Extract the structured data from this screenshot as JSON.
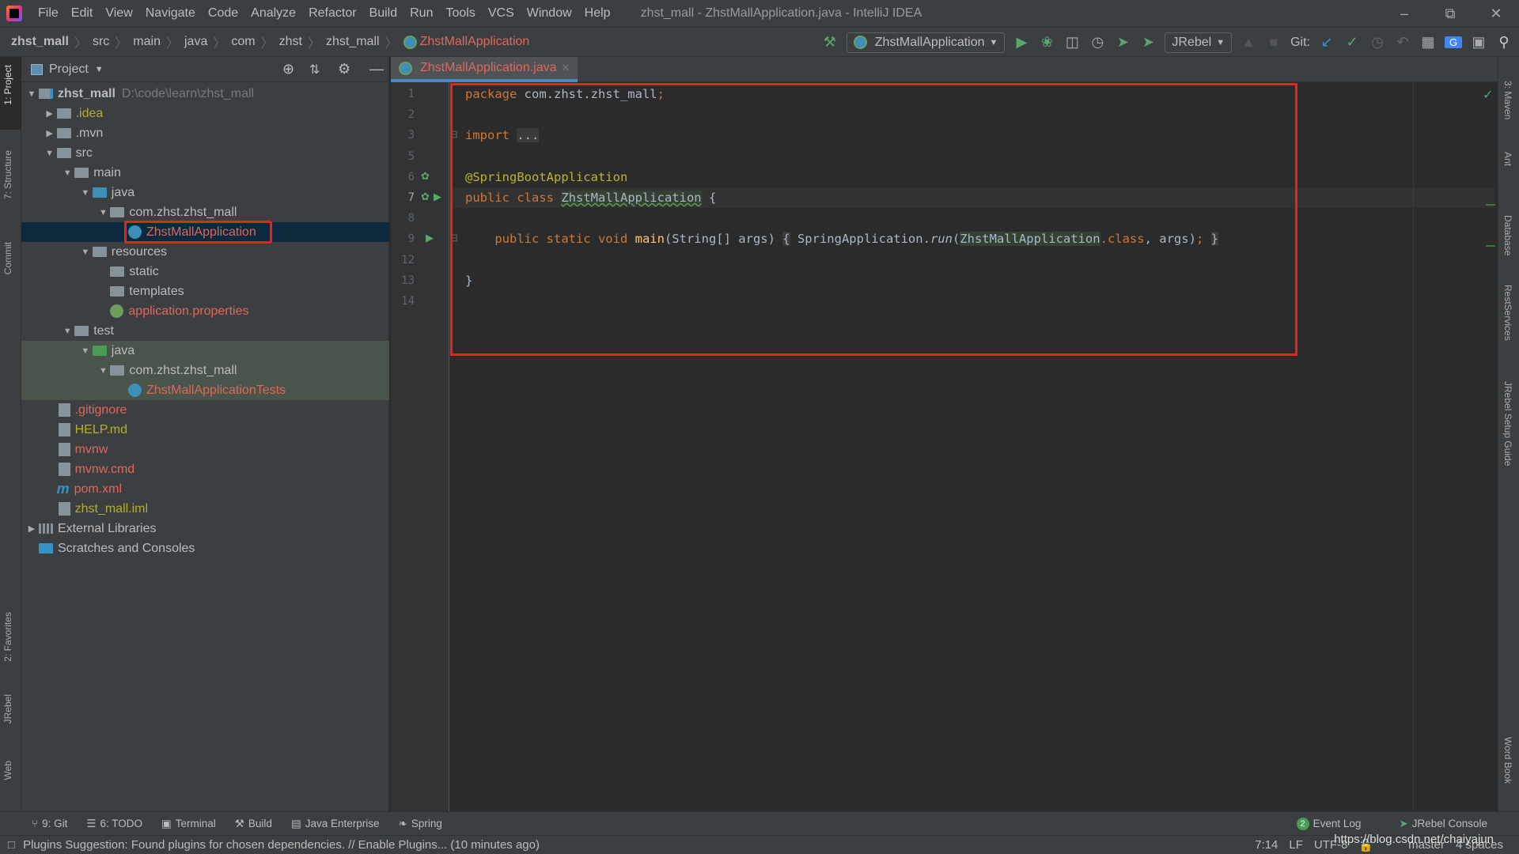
{
  "window": {
    "title": "zhst_mall - ZhstMallApplication.java - IntelliJ IDEA"
  },
  "menu": [
    "File",
    "Edit",
    "View",
    "Navigate",
    "Code",
    "Analyze",
    "Refactor",
    "Build",
    "Run",
    "Tools",
    "VCS",
    "Window",
    "Help"
  ],
  "breadcrumb": [
    "zhst_mall",
    "src",
    "main",
    "java",
    "com",
    "zhst",
    "zhst_mall",
    "ZhstMallApplication"
  ],
  "toolbar": {
    "run_config": "ZhstMallApplication",
    "jrebel": "JRebel",
    "git_label": "Git:"
  },
  "left_strip": [
    "1: Project",
    "7: Structure",
    "Commit",
    "2: Favorites",
    "JRebel",
    "Web"
  ],
  "right_strip": [
    "3: Maven",
    "Ant",
    "Database",
    "RestServices",
    "JRebel Setup Guide",
    "Word Book"
  ],
  "project": {
    "title": "Project",
    "tree": [
      {
        "label": "zhst_mall",
        "path": "D:\\code\\learn\\zhst_mall",
        "level": 0,
        "arrow": "down",
        "icon": "module-folder",
        "color": "#bbbbbb"
      },
      {
        "label": ".idea",
        "level": 1,
        "arrow": "right",
        "icon": "folder",
        "color": "#b3ae28"
      },
      {
        "label": ".mvn",
        "level": 1,
        "arrow": "right",
        "icon": "folder",
        "color": "#bbbbbb"
      },
      {
        "label": "src",
        "level": 1,
        "arrow": "down",
        "icon": "folder",
        "color": "#bbbbbb"
      },
      {
        "label": "main",
        "level": 2,
        "arrow": "down",
        "icon": "folder",
        "color": "#bbbbbb"
      },
      {
        "label": "java",
        "level": 3,
        "arrow": "down",
        "icon": "source-folder",
        "color": "#bbbbbb"
      },
      {
        "label": "com.zhst.zhst_mall",
        "level": 4,
        "arrow": "down",
        "icon": "package",
        "color": "#bbbbbb"
      },
      {
        "label": "ZhstMallApplication",
        "level": 5,
        "arrow": "",
        "icon": "spring-class",
        "color": "#e0665a",
        "selected": true
      },
      {
        "label": "resources",
        "level": 3,
        "arrow": "down",
        "icon": "resources-folder",
        "color": "#bbbbbb"
      },
      {
        "label": "static",
        "level": 4,
        "arrow": "",
        "icon": "folder",
        "color": "#bbbbbb"
      },
      {
        "label": "templates",
        "level": 4,
        "arrow": "",
        "icon": "folder",
        "color": "#bbbbbb"
      },
      {
        "label": "application.properties",
        "level": 4,
        "arrow": "",
        "icon": "spring-properties",
        "color": "#e0665a"
      },
      {
        "label": "test",
        "level": 2,
        "arrow": "down",
        "icon": "folder",
        "color": "#bbbbbb"
      },
      {
        "label": "java",
        "level": 3,
        "arrow": "down",
        "icon": "test-folder",
        "color": "#bbbbbb",
        "test": true
      },
      {
        "label": "com.zhst.zhst_mall",
        "level": 4,
        "arrow": "down",
        "icon": "package",
        "color": "#bbbbbb",
        "test": true
      },
      {
        "label": "ZhstMallApplicationTests",
        "level": 5,
        "arrow": "",
        "icon": "class",
        "color": "#e0665a",
        "test": true
      },
      {
        "label": ".gitignore",
        "level": 1,
        "arrow": "",
        "icon": "gitignore-file",
        "color": "#e0665a"
      },
      {
        "label": "HELP.md",
        "level": 1,
        "arrow": "",
        "icon": "markdown-file",
        "color": "#b3ae28"
      },
      {
        "label": "mvnw",
        "level": 1,
        "arrow": "",
        "icon": "shell-file",
        "color": "#e0665a"
      },
      {
        "label": "mvnw.cmd",
        "level": 1,
        "arrow": "",
        "icon": "text-file",
        "color": "#e0665a"
      },
      {
        "label": "pom.xml",
        "level": 1,
        "arrow": "",
        "icon": "maven-file",
        "color": "#e0665a"
      },
      {
        "label": "zhst_mall.iml",
        "level": 1,
        "arrow": "",
        "icon": "iml-file",
        "color": "#b3ae28"
      },
      {
        "label": "External Libraries",
        "level": 0,
        "arrow": "right",
        "icon": "libraries",
        "color": "#bbbbbb"
      },
      {
        "label": "Scratches and Consoles",
        "level": 0,
        "arrow": "",
        "icon": "scratches",
        "color": "#bbbbbb"
      }
    ]
  },
  "editor": {
    "tab": "ZhstMallApplication.java",
    "current_line": "7",
    "lines": [
      {
        "n": "1",
        "tokens": [
          {
            "t": "package ",
            "c": "kw"
          },
          {
            "t": "com.zhst.zhst_mall"
          },
          {
            "t": ";",
            "c": "kw"
          }
        ]
      },
      {
        "n": "2",
        "tokens": []
      },
      {
        "n": "3",
        "tokens": [
          {
            "t": "import ",
            "c": "kw"
          },
          {
            "t": "...",
            "c": "fold"
          }
        ]
      },
      {
        "n": "5",
        "tokens": []
      },
      {
        "n": "6",
        "tokens": [
          {
            "t": "@SpringBootApplication",
            "c": "ann"
          }
        ]
      },
      {
        "n": "7",
        "tokens": [
          {
            "t": "public class ",
            "c": "kw"
          },
          {
            "t": "ZhstMallApplication",
            "c": "hl ul"
          },
          {
            "t": " {"
          }
        ]
      },
      {
        "n": "8",
        "tokens": []
      },
      {
        "n": "9",
        "tokens": [
          {
            "t": "    public static void ",
            "c": "kw"
          },
          {
            "t": "main",
            "c": "fn"
          },
          {
            "t": "(String[] args) "
          },
          {
            "t": "{",
            "c": "fold"
          },
          {
            "t": " SpringApplication."
          },
          {
            "t": "run",
            "c": "it"
          },
          {
            "t": "("
          },
          {
            "t": "ZhstMallApplication",
            "c": "hl"
          },
          {
            "t": ".",
            "c": "kw"
          },
          {
            "t": "class",
            "c": "kw"
          },
          {
            "t": ", args)"
          },
          {
            "t": ";",
            "c": "kw"
          },
          {
            "t": " "
          },
          {
            "t": "}",
            "c": "fold"
          }
        ]
      },
      {
        "n": "12",
        "tokens": []
      },
      {
        "n": "13",
        "tokens": [
          {
            "t": "}"
          }
        ]
      },
      {
        "n": "14",
        "tokens": []
      }
    ]
  },
  "tool_windows": [
    {
      "label": "9: Git",
      "icon": "git-icon"
    },
    {
      "label": "6: TODO",
      "icon": "todo-icon"
    },
    {
      "label": "Terminal",
      "icon": "terminal-icon"
    },
    {
      "label": "Build",
      "icon": "build-icon"
    },
    {
      "label": "Java Enterprise",
      "icon": "java-enterprise-icon"
    },
    {
      "label": "Spring",
      "icon": "spring-icon"
    }
  ],
  "tool_windows_right": {
    "event_log": "Event Log",
    "event_count": "2",
    "jrebel_console": "JRebel Console"
  },
  "status": {
    "message": "Plugins Suggestion: Found plugins for chosen dependencies. // Enable Plugins... (10 minutes ago)",
    "position": "7:14",
    "line_sep": "LF",
    "encoding": "UTF-8",
    "branch": "master",
    "indent": "4 spaces",
    "watermark": "https://blog.csdn.net/chaiyajun"
  },
  "colors": {
    "accent": "#4a88c7",
    "highlight_box": "#f0201d",
    "selection": "#0d293e"
  }
}
